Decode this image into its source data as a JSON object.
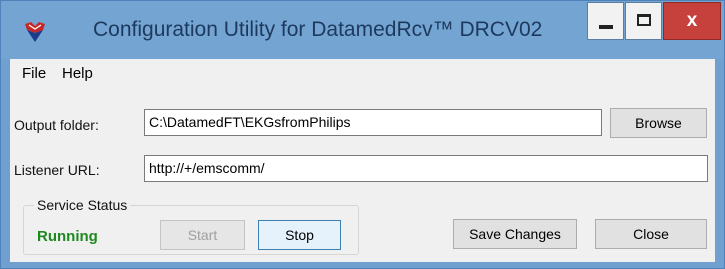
{
  "window": {
    "title": "Configuration Utility for DatamedRcv™ DRCV02",
    "icon": "datamed-app-icon",
    "controls": {
      "minimize": "minimize-icon",
      "maximize": "maximize-icon",
      "close_glyph": "x"
    }
  },
  "menu": {
    "items": [
      {
        "label": "File"
      },
      {
        "label": "Help"
      }
    ]
  },
  "output_folder": {
    "label": "Output folder:",
    "value": "C:\\DatamedFT\\EKGsfromPhilips",
    "browse_label": "Browse"
  },
  "listener_url": {
    "label": "Listener URL:",
    "value": "http://+/emscomm/"
  },
  "service_status": {
    "group_label": "Service Status",
    "status_text": "Running",
    "status_color": "#1e8a1e",
    "start_label": "Start",
    "stop_label": "Stop"
  },
  "actions": {
    "save_label": "Save Changes",
    "close_label": "Close"
  }
}
